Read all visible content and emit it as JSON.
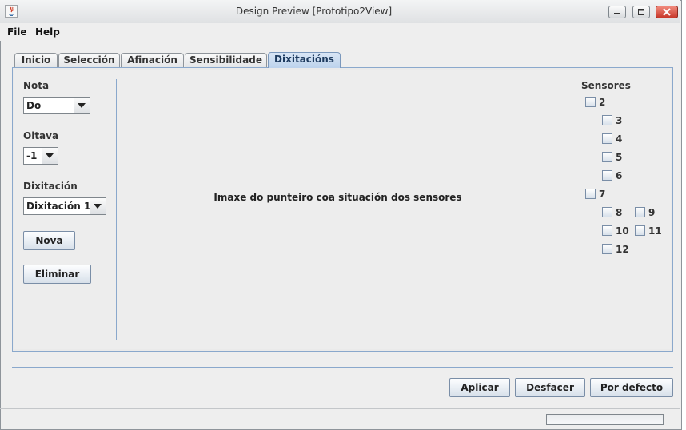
{
  "window": {
    "title": "Design Preview [Prototipo2View]"
  },
  "menu": {
    "items": [
      "File",
      "Help"
    ]
  },
  "tabs": [
    {
      "label": "Inicio",
      "active": false
    },
    {
      "label": "Selección",
      "active": false
    },
    {
      "label": "Afinación",
      "active": false
    },
    {
      "label": "Sensibilidade",
      "active": false
    },
    {
      "label": "Dixitacións",
      "active": true
    }
  ],
  "left": {
    "nota_label": "Nota",
    "nota_value": "Do",
    "oitava_label": "Oitava",
    "oitava_value": "-1",
    "dixitacion_label": "Dixitación",
    "dixitacion_value": "Dixitación 1",
    "nova_button": "Nova",
    "eliminar_button": "Eliminar"
  },
  "center": {
    "text": "Imaxe do punteiro coa situación dos sensores"
  },
  "sensors": {
    "title": "Sensores",
    "items": [
      "2",
      "3",
      "4",
      "5",
      "6",
      "7",
      "8",
      "9",
      "10",
      "11",
      "12"
    ],
    "checked": []
  },
  "bottom": {
    "aplicar_button": "Aplicar",
    "desfacer_button": "Desfacer",
    "por_defecto_button": "Por defecto"
  },
  "progress": {
    "value": 0
  }
}
